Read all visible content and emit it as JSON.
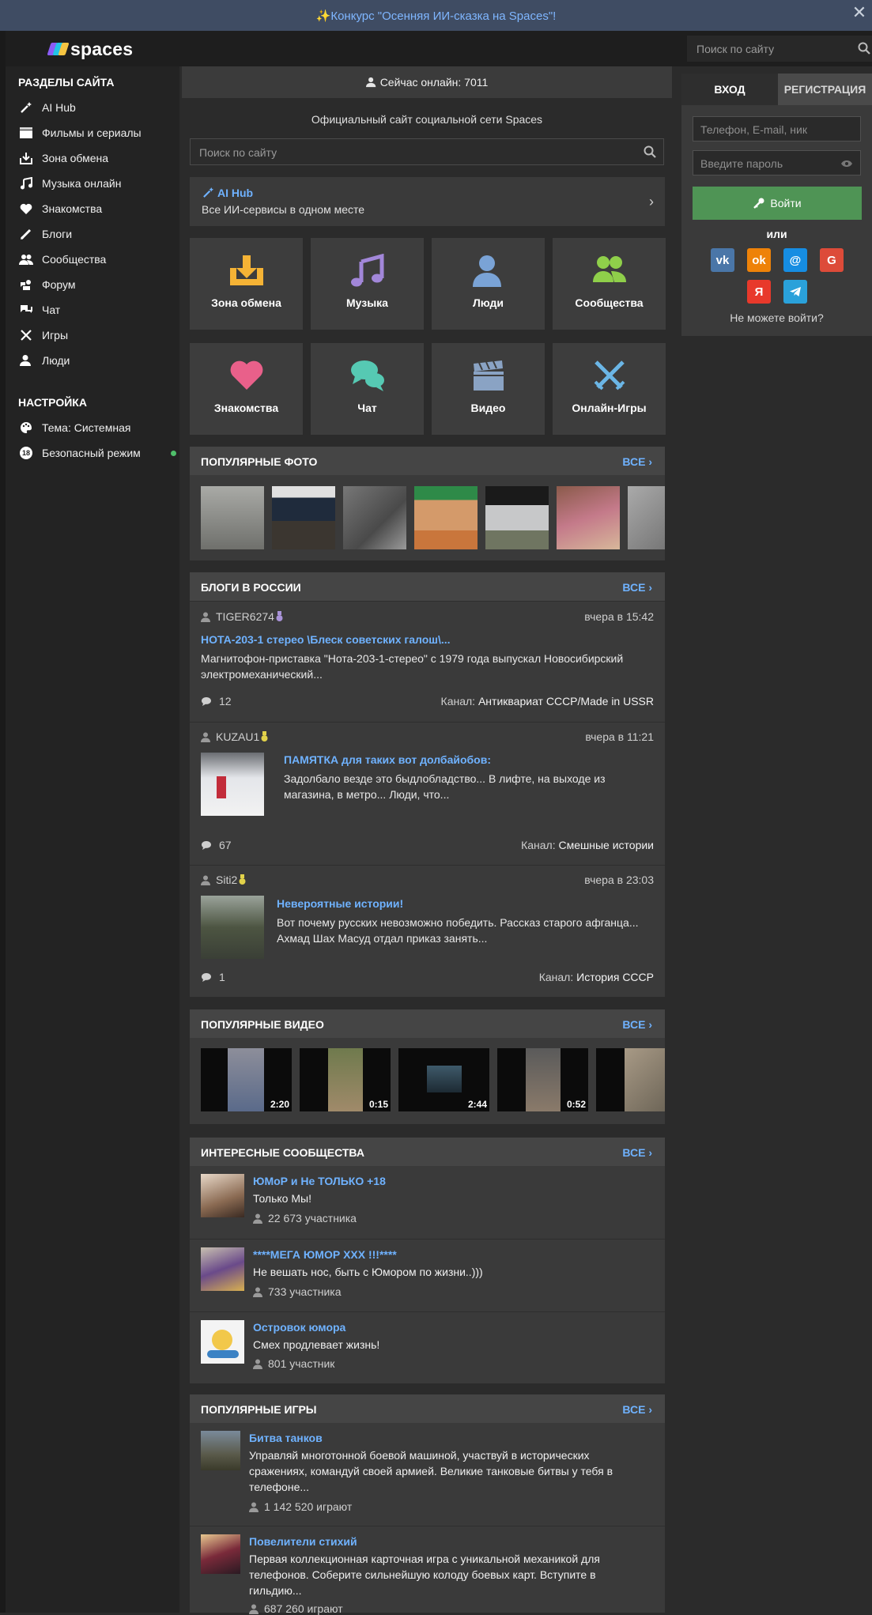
{
  "banner": {
    "text": "✨Конкурс \"Осенняя ИИ-сказка на Spaces\"!",
    "close": "✕"
  },
  "header": {
    "logo": "spaces",
    "search_placeholder": "Поиск по сайту"
  },
  "sidebar": {
    "sections_title": "РАЗДЕЛЫ САЙТА",
    "items": [
      {
        "label": "AI Hub",
        "icon": "magic-wand-icon"
      },
      {
        "label": "Фильмы и сериалы",
        "icon": "film-icon"
      },
      {
        "label": "Зона обмена",
        "icon": "download-icon"
      },
      {
        "label": "Музыка онлайн",
        "icon": "music-note-icon"
      },
      {
        "label": "Знакомства",
        "icon": "heart-icon"
      },
      {
        "label": "Блоги",
        "icon": "pen-icon"
      },
      {
        "label": "Сообщества",
        "icon": "group-icon"
      },
      {
        "label": "Форум",
        "icon": "forum-icon"
      },
      {
        "label": "Чат",
        "icon": "chat-icon"
      },
      {
        "label": "Игры",
        "icon": "swords-icon"
      },
      {
        "label": "Люди",
        "icon": "people-icon"
      }
    ],
    "settings_title": "НАСТРОЙКА",
    "settings": [
      {
        "label": "Тема: Системная",
        "icon": "palette-icon"
      },
      {
        "label": "Безопасный режим",
        "icon": "18-badge",
        "badge": "18"
      }
    ]
  },
  "main": {
    "online": "Сейчас онлайн: 7011",
    "subtitle": "Официальный сайт социальной сети Spaces",
    "search_placeholder": "Поиск по сайту",
    "aihub": {
      "title": "AI Hub",
      "subtitle": "Все ИИ-сервисы в одном месте"
    },
    "tiles": [
      {
        "label": "Зона обмена",
        "color": "#f5b335"
      },
      {
        "label": "Музыка",
        "color": "#a287d9"
      },
      {
        "label": "Люди",
        "color": "#7aa3d6"
      },
      {
        "label": "Сообщества",
        "color": "#8fcf4a"
      },
      {
        "label": "Знакомства",
        "color": "#e9608a"
      },
      {
        "label": "Чат",
        "color": "#56c9b3"
      },
      {
        "label": "Видео",
        "color": "#8aa3c4"
      },
      {
        "label": "Онлайн-Игры",
        "color": "#6bb6e6"
      }
    ],
    "popular_photos": {
      "title": "ПОПУЛЯРНЫЕ ФОТО",
      "all": "ВСЕ"
    },
    "blogs": {
      "title": "БЛОГИ В РОССИИ",
      "all": "ВСЕ",
      "channel_label": "Канал:",
      "posts": [
        {
          "user": "TIGER6274",
          "date": "вчера в 15:42",
          "title": "НОТА-203-1 стерео \\Блеск советских галош\\...",
          "text": "Магнитофон-приставка \"Нота-203-1-стерео\" с 1979 года выпускал Новосибирский электромеханический...",
          "comments": "12",
          "channel": "Антиквариат СССР/Made in USSR"
        },
        {
          "user": "KUZAU1",
          "date": "вчера в 11:21",
          "title": "ПАМЯТКА для таких вот долбайобов:",
          "text": "Задолбало везде это быдлобладство... В лифте, на выходе из магазина, в метро... Люди, что...",
          "comments": "67",
          "channel": "Смешные истории"
        },
        {
          "user": "Siti2",
          "date": "вчера в 23:03",
          "title": "Невероятные истории!",
          "text": "Вот почему русских невозможно победить. Рассказ старого афганца... Ахмад Шах Масуд отдал приказ занять...",
          "comments": "1",
          "channel": "История СССР"
        }
      ]
    },
    "videos": {
      "title": "ПОПУЛЯРНЫЕ ВИДЕО",
      "all": "ВСЕ",
      "durations": [
        "2:20",
        "0:15",
        "2:44",
        "0:52"
      ]
    },
    "communities": {
      "title": "ИНТЕРЕСНЫЕ СООБЩЕСТВА",
      "all": "ВСЕ",
      "items": [
        {
          "name": "ЮМоР и Не ТОЛЬКО +18",
          "desc": "Только Мы!",
          "count": "22 673 участника"
        },
        {
          "name": "****МЕГА ЮМОР XXX !!!****",
          "desc": "Не вешать нос, быть с Юмором по жизни..)))",
          "count": "733 участника"
        },
        {
          "name": "Островок юмора",
          "desc": "Смех продлевает жизнь!",
          "count": "801 участник"
        }
      ]
    },
    "games": {
      "title": "ПОПУЛЯРНЫЕ ИГРЫ",
      "all": "ВСЕ",
      "items": [
        {
          "name": "Битва танков",
          "desc1": "Управляй многотонной боевой машиной, участвуй в исторических",
          "desc2": "сражениях, командуй своей армией. Великие танковые битвы у тебя в",
          "desc3": "телефоне...",
          "count": "1 142 520 играют"
        },
        {
          "name": "Повелители стихий",
          "desc1": "Первая коллекционная карточная игра с уникальной механикой для",
          "desc2": "телефонов. Соберите сильнейшую колоду боевых карт. Вступите в",
          "desc3": "гильдию...",
          "count": "687 260 играют"
        }
      ]
    }
  },
  "auth": {
    "tab_login": "ВХОД",
    "tab_register": "РЕГИСТРАЦИЯ",
    "login_placeholder": "Телефон, E-mail, ник",
    "password_placeholder": "Введите пароль",
    "submit": "Войти",
    "or": "или",
    "social": [
      "vk",
      "ok",
      "@",
      "G",
      "Я",
      "tg"
    ],
    "forgot": "Не можете войти?"
  }
}
